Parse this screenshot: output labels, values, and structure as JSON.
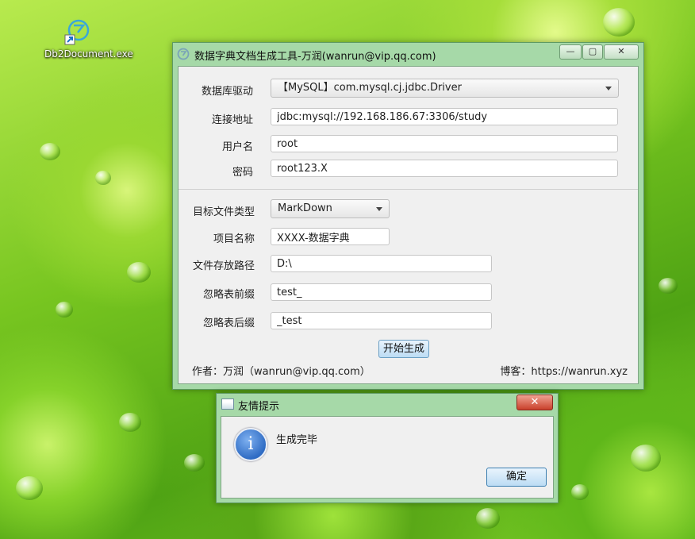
{
  "desktop": {
    "icon_label": "Db2Document.exe"
  },
  "main_window": {
    "title": "数据字典文档生成工具-万润(wanrun@vip.qq.com)",
    "controls": {
      "minimize": "—",
      "maximize": "▢",
      "close": "✕"
    },
    "db_driver": {
      "label": "数据库驱动",
      "value": "【MySQL】com.mysql.cj.jdbc.Driver"
    },
    "url": {
      "label": "连接地址",
      "value": "jdbc:mysql://192.168.186.67:3306/study"
    },
    "username": {
      "label": "用户名",
      "value": "root"
    },
    "password": {
      "label": "密码",
      "value": "root123.X"
    },
    "file_type": {
      "label": "目标文件类型",
      "value": "MarkDown"
    },
    "project_name": {
      "label": "项目名称",
      "value": "XXXX-数据字典"
    },
    "save_path": {
      "label": "文件存放路径",
      "value": "D:\\"
    },
    "ignore_prefix": {
      "label": "忽略表前缀",
      "value": "test_"
    },
    "ignore_suffix": {
      "label": "忽略表后缀",
      "value": "_test"
    },
    "generate_button": "开始生成",
    "author": "作者：万润（wanrun@vip.qq.com）",
    "blog": "博客：https://wanrun.xyz"
  },
  "dialog": {
    "title": "友情提示",
    "close": "✕",
    "message": "生成完毕",
    "ok_button": "确定",
    "icon_glyph": "i"
  }
}
